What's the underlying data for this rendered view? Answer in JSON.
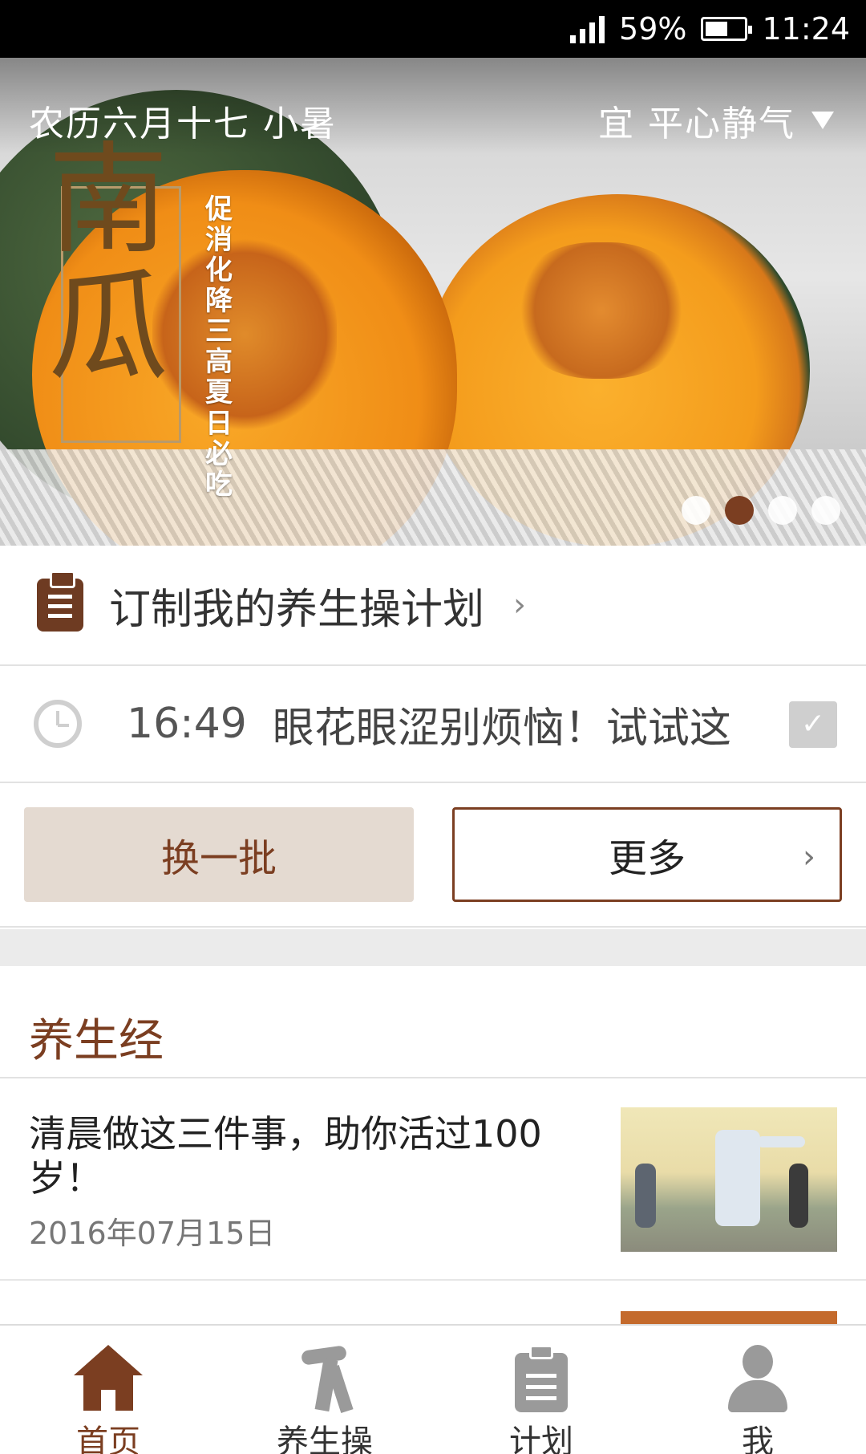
{
  "status_bar": {
    "battery": "59%",
    "battery_level": 0.59,
    "time": "11:24"
  },
  "banner": {
    "lunar_date": "农历六月十七  小暑",
    "advice": "宜 平心静气",
    "calligraphy_title": "南瓜",
    "calligraphy_chars": [
      "南",
      "瓜"
    ],
    "vertical_text": "促消化降三高 夏日必吃",
    "slide_count": 4,
    "active_slide": 2
  },
  "plan_row": {
    "label": "订制我的养生操计划",
    "chevron": "›"
  },
  "reminder": {
    "time": "16:49",
    "text": "眼花眼涩别烦恼！试试这",
    "checked": true,
    "check_glyph": "✓"
  },
  "buttons": {
    "swap_label": "换一批",
    "more_label": "更多",
    "more_chevron": "›"
  },
  "section": {
    "title": "养生经"
  },
  "articles": [
    {
      "title": "清晨做这三件事，助你活过100岁！",
      "date": "2016年07月15日"
    }
  ],
  "tabs": [
    {
      "label": "首页",
      "icon": "home-icon",
      "active": true
    },
    {
      "label": "养生操",
      "icon": "exercise-icon",
      "active": false
    },
    {
      "label": "计划",
      "icon": "clipboard-icon",
      "active": false
    },
    {
      "label": "我",
      "icon": "user-icon",
      "active": false
    }
  ],
  "colors": {
    "accent": "#7b3e21",
    "button_bg": "#e4dad1",
    "inactive_icon": "#9a9a9a"
  }
}
